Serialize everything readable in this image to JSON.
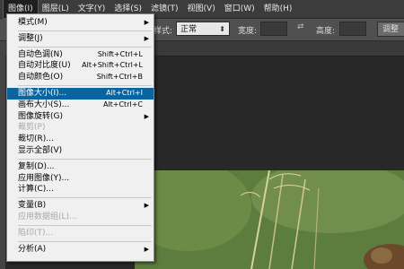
{
  "menubar": {
    "items": [
      {
        "label": "图像(I)",
        "active": true
      },
      {
        "label": "图层(L)"
      },
      {
        "label": "文字(Y)"
      },
      {
        "label": "选择(S)"
      },
      {
        "label": "滤镜(T)"
      },
      {
        "label": "视图(V)"
      },
      {
        "label": "窗口(W)"
      },
      {
        "label": "帮助(H)"
      }
    ]
  },
  "options_bar": {
    "style_label": "样式:",
    "style_value": "正常",
    "width_label": "宽度:",
    "height_label": "高度:",
    "adjust_button": "调整"
  },
  "image_menu": {
    "items": [
      {
        "label": "模式(M)",
        "submenu": true
      },
      {
        "type": "sep"
      },
      {
        "label": "调整(J)",
        "submenu": true
      },
      {
        "type": "sep"
      },
      {
        "label": "自动色调(N)",
        "shortcut": "Shift+Ctrl+L"
      },
      {
        "label": "自动对比度(U)",
        "shortcut": "Alt+Shift+Ctrl+L"
      },
      {
        "label": "自动颜色(O)",
        "shortcut": "Shift+Ctrl+B"
      },
      {
        "type": "sep"
      },
      {
        "label": "图像大小(I)...",
        "shortcut": "Alt+Ctrl+I",
        "highlighted": true
      },
      {
        "label": "画布大小(S)...",
        "shortcut": "Alt+Ctrl+C"
      },
      {
        "label": "图像旋转(G)",
        "submenu": true
      },
      {
        "label": "裁剪(P)",
        "disabled": true
      },
      {
        "label": "裁切(R)..."
      },
      {
        "label": "显示全部(V)"
      },
      {
        "type": "sep"
      },
      {
        "label": "复制(D)..."
      },
      {
        "label": "应用图像(Y)..."
      },
      {
        "label": "计算(C)..."
      },
      {
        "type": "sep"
      },
      {
        "label": "变量(B)",
        "submenu": true
      },
      {
        "label": "应用数据组(L)...",
        "disabled": true
      },
      {
        "type": "sep"
      },
      {
        "label": "陷印(T)...",
        "disabled": true
      },
      {
        "type": "sep"
      },
      {
        "label": "分析(A)",
        "submenu": true
      }
    ]
  },
  "colors": {
    "highlight": "#0a64a0",
    "menubar": "#3c3c3c",
    "workspace": "#282828"
  }
}
